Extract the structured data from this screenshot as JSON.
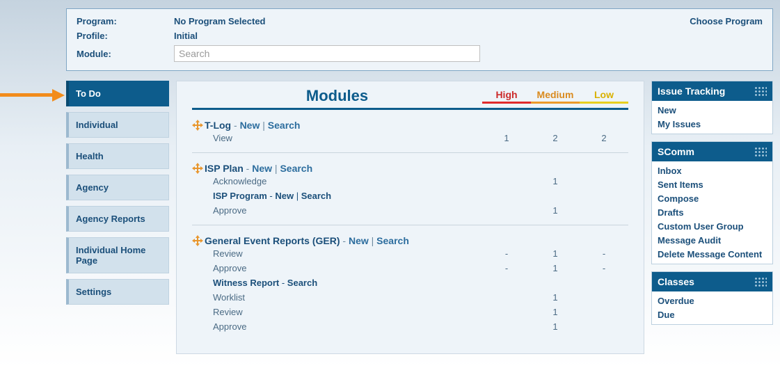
{
  "context": {
    "program_label": "Program:",
    "program_value": "No Program Selected",
    "profile_label": "Profile:",
    "profile_value": "Initial",
    "module_label": "Module:",
    "search_placeholder": "Search",
    "choose_program": "Choose Program"
  },
  "leftnav": {
    "items": [
      {
        "label": "To Do",
        "active": true
      },
      {
        "label": "Individual"
      },
      {
        "label": "Health"
      },
      {
        "label": "Agency"
      },
      {
        "label": "Agency Reports"
      },
      {
        "label": "Individual Home Page"
      },
      {
        "label": "Settings"
      }
    ]
  },
  "modules": {
    "title": "Modules",
    "priority_labels": {
      "high": "High",
      "medium": "Medium",
      "low": "Low"
    },
    "link_new": "New",
    "link_search": "Search",
    "sep": " | ",
    "dash_prefix": " - ",
    "groups": [
      {
        "name": "T-Log",
        "links": [
          "new",
          "search"
        ],
        "rows": [
          {
            "label": "View",
            "high": "1",
            "medium": "2",
            "low": "2"
          }
        ]
      },
      {
        "name": "ISP Plan",
        "links": [
          "new",
          "search"
        ],
        "rows": [
          {
            "label": "Acknowledge",
            "high": "",
            "medium": "1",
            "low": ""
          }
        ],
        "sub": {
          "name": "ISP Program",
          "links": [
            "new",
            "search"
          ],
          "rows": [
            {
              "label": "Approve",
              "high": "",
              "medium": "1",
              "low": ""
            }
          ]
        }
      },
      {
        "name": "General Event Reports (GER)",
        "links": [
          "new",
          "search"
        ],
        "rows": [
          {
            "label": "Review",
            "high": "-",
            "medium": "1",
            "low": "-"
          },
          {
            "label": "Approve",
            "high": "-",
            "medium": "1",
            "low": "-"
          }
        ],
        "sub": {
          "name": "Witness Report",
          "links": [
            "search"
          ],
          "rows": [
            {
              "label": "Worklist",
              "high": "",
              "medium": "1",
              "low": ""
            },
            {
              "label": "Review",
              "high": "",
              "medium": "1",
              "low": ""
            },
            {
              "label": "Approve",
              "high": "",
              "medium": "1",
              "low": ""
            }
          ]
        }
      }
    ]
  },
  "right": {
    "panels": [
      {
        "title": "Issue Tracking",
        "items": [
          "New",
          "My Issues"
        ]
      },
      {
        "title": "SComm",
        "items": [
          "Inbox",
          "Sent Items",
          "Compose",
          "Drafts",
          "Custom User Group",
          "Message Audit",
          "Delete Message Content"
        ]
      },
      {
        "title": "Classes",
        "items": [
          "Overdue",
          "Due"
        ]
      }
    ]
  }
}
